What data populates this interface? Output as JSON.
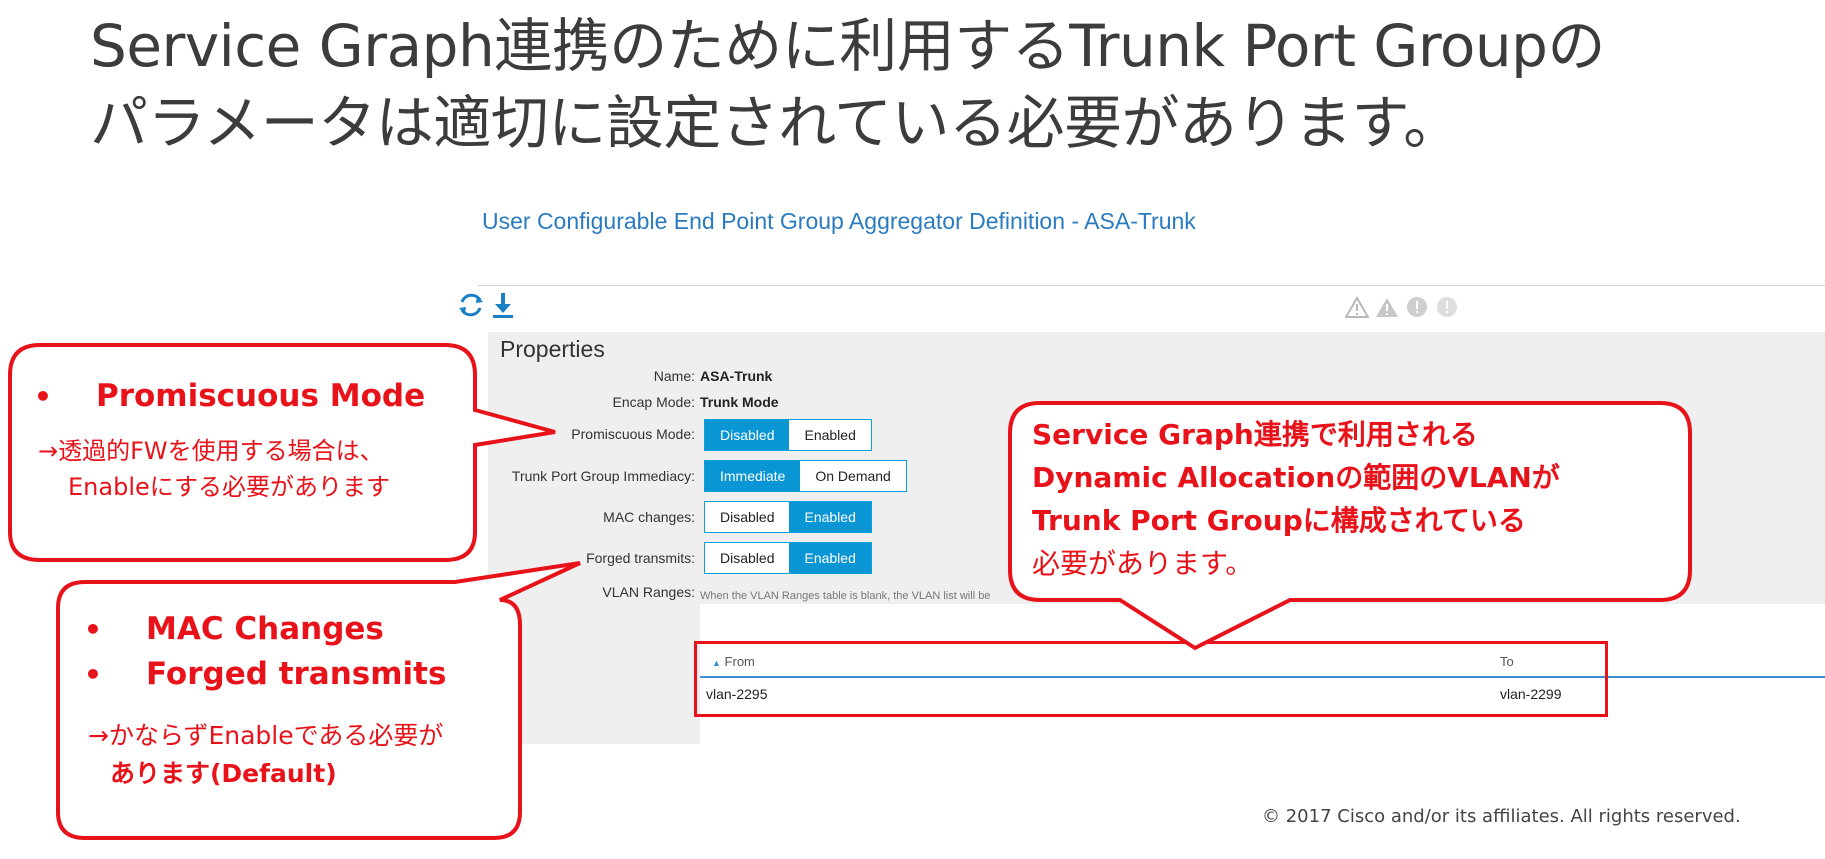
{
  "slide": {
    "title_line1": "Service Graph連携のために利用するTrunk Port Groupの",
    "title_line2": "パラメータは適切に設定されている必要があります。",
    "copyright": "© 2017  Cisco and/or its affiliates. All rights reserved."
  },
  "ui": {
    "header": "User Configurable End Point Group Aggregator Definition - ASA-Trunk",
    "properties": {
      "title": "Properties",
      "name_label": "Name:",
      "name_value": "ASA-Trunk",
      "encap_label": "Encap Mode:",
      "encap_value": "Trunk Mode",
      "promiscuous_label": "Promiscuous Mode:",
      "immediacy_label": "Trunk Port Group Immediacy:",
      "mac_label": "MAC changes:",
      "forged_label": "Forged transmits:",
      "vlan_label": "VLAN Ranges:",
      "vlan_hint": "When the VLAN Ranges table is blank, the VLAN list will be",
      "promiscuous_options": [
        "Disabled",
        "Enabled"
      ],
      "promiscuous_selected": "Disabled",
      "immediacy_options": [
        "Immediate",
        "On Demand"
      ],
      "immediacy_selected": "Immediate",
      "mac_options": [
        "Disabled",
        "Enabled"
      ],
      "mac_selected": "Enabled",
      "forged_options": [
        "Disabled",
        "Enabled"
      ],
      "forged_selected": "Enabled"
    },
    "vlan_table": {
      "col_from": "From",
      "col_to": "To",
      "rows": [
        {
          "from": "vlan-2295",
          "to": "vlan-2299"
        }
      ]
    },
    "icons": [
      "refresh-icon",
      "download-icon",
      "critical-warning-icon",
      "warning-icon",
      "minor-fault-icon",
      "info-icon"
    ]
  },
  "callouts": {
    "promiscuous": {
      "heading": "Promiscuous Mode",
      "line1": "→透過的FWを使用する場合は、",
      "line2": "Enableにする必要があります"
    },
    "mac_forged": {
      "heading1": "MAC Changes",
      "heading2": "Forged transmits",
      "line1": "→かならずEnableである必要が",
      "line2": "あります(Default)"
    },
    "service_graph": {
      "line1": "Service Graph連携で利用される",
      "line2": "Dynamic Allocationの範囲のVLANが",
      "line3": "Trunk Port Groupに構成されている",
      "line4": "必要があります。"
    }
  },
  "colors": {
    "accent_red": "#e8131a",
    "toggle_blue": "#0a96d4",
    "header_blue": "#2a7bbf"
  }
}
